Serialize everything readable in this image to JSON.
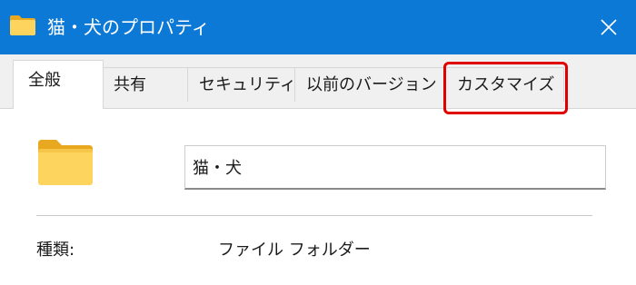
{
  "window": {
    "title": "猫・犬のプロパティ",
    "title_icon": "folder-icon",
    "close_icon": "close-icon"
  },
  "tabs": [
    {
      "label": "全般",
      "active": true
    },
    {
      "label": "共有",
      "active": false
    },
    {
      "label": "セキュリティ",
      "active": false
    },
    {
      "label": "以前のバージョン",
      "active": false
    },
    {
      "label": "カスタマイズ",
      "active": false,
      "highlighted": true
    }
  ],
  "general": {
    "folder_icon": "folder-icon",
    "name_value": "猫・犬",
    "properties": [
      {
        "label": "種類:",
        "value": "ファイル フォルダー"
      }
    ]
  },
  "colors": {
    "titlebar": "#0d79d6",
    "highlight": "#e00000",
    "folder": "#f7c94b"
  }
}
